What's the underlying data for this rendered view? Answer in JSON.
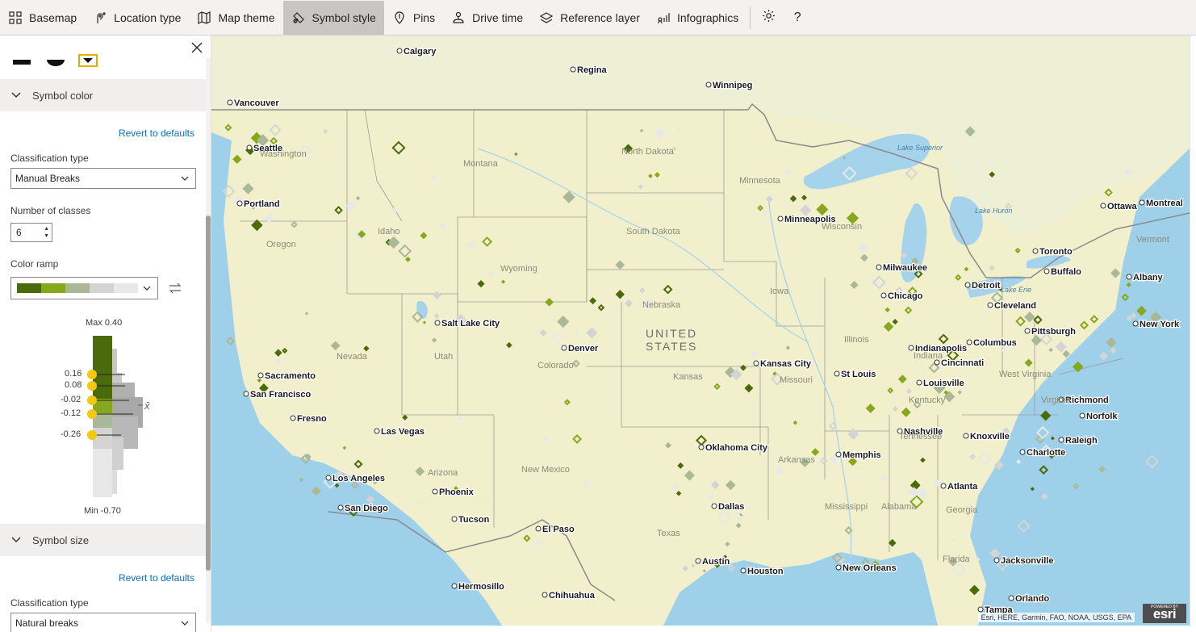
{
  "toolbar": {
    "items": [
      {
        "label": "Basemap",
        "icon": "basemap-grid-icon"
      },
      {
        "label": "Location type",
        "icon": "location-type-icon"
      },
      {
        "label": "Map theme",
        "icon": "map-theme-icon"
      },
      {
        "label": "Symbol style",
        "icon": "symbol-style-icon",
        "active": true
      },
      {
        "label": "Pins",
        "icon": "pin-icon"
      },
      {
        "label": "Drive time",
        "icon": "drive-time-icon"
      },
      {
        "label": "Reference layer",
        "icon": "layers-icon"
      },
      {
        "label": "Infographics",
        "icon": "infographics-icon"
      }
    ],
    "settings_icon": "gear-icon",
    "help_label": "?"
  },
  "panel": {
    "symbol_color": {
      "header": "Symbol color",
      "revert": "Revert to defaults",
      "classification_label": "Classification type",
      "classification_value": "Manual Breaks",
      "classes_label": "Number of classes",
      "classes_value": "6",
      "ramp_label": "Color ramp",
      "ramp_colors": [
        "#4b6a0a",
        "#86a81c",
        "#aab898",
        "#d4d4d4",
        "#e8e8e8"
      ],
      "max_label": "Max 0.40",
      "min_label": "Min -0.70",
      "breaks": [
        "0.16",
        "0.08",
        "-0.02",
        "-0.12",
        "-0.26"
      ],
      "mean_symbol": "x̄"
    },
    "symbol_size": {
      "header": "Symbol size",
      "revert": "Revert to defaults",
      "classification_label": "Classification type",
      "classification_value": "Natural breaks"
    }
  },
  "map": {
    "countries": [
      {
        "name": "UNITED"
      },
      {
        "name": "STATES"
      }
    ],
    "states": [
      "Washington",
      "Oregon",
      "Idaho",
      "Montana",
      "Wyoming",
      "Nevada",
      "Utah",
      "Colorado",
      "Arizona",
      "New Mexico",
      "North Dakota",
      "South Dakota",
      "Nebraska",
      "Kansas",
      "Texas",
      "Minnesota",
      "Iowa",
      "Missouri",
      "Arkansas",
      "Wisconsin",
      "Illinois",
      "Indiana",
      "Kentucky",
      "Tennessee",
      "Mississippi",
      "Alabama",
      "Georgia",
      "Florida",
      "West Virginia",
      "Virginia",
      "Vermont",
      "Lake Superior",
      "Lake Huron",
      "Lake Erie"
    ],
    "cities": [
      "Calgary",
      "Regina",
      "Winnipeg",
      "Vancouver",
      "Seattle",
      "Portland",
      "Sacramento",
      "San Francisco",
      "Fresno",
      "Los Angeles",
      "San Diego",
      "Las Vegas",
      "Phoenix",
      "Tucson",
      "Salt Lake City",
      "Denver",
      "El Paso",
      "Hermosillo",
      "Chihuahua",
      "Oklahoma City",
      "Dallas",
      "Austin",
      "Houston",
      "Kansas City",
      "St Louis",
      "Minneapolis",
      "Milwaukee",
      "Chicago",
      "Detroit",
      "Toronto",
      "Ottawa",
      "Montreal",
      "Cleveland",
      "Buffalo",
      "Pittsburgh",
      "Columbus",
      "Indianapolis",
      "Cincinnati",
      "Louisville",
      "Nashville",
      "Knoxville",
      "Memphis",
      "Atlanta",
      "Charlotte",
      "Raleigh",
      "Richmond",
      "Norfolk",
      "New York",
      "Albany",
      "Jacksonville",
      "Orlando",
      "Tampa",
      "New Orleans"
    ],
    "attribution": "Esri, HERE, Garmin, FAO, NOAA, USGS, EPA",
    "logo_text": "esri",
    "logo_small": "POWERED BY"
  }
}
